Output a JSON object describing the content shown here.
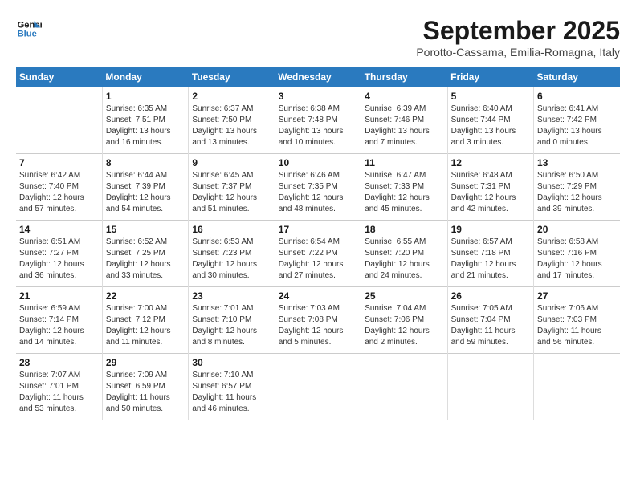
{
  "header": {
    "logo_line1": "General",
    "logo_line2": "Blue",
    "month": "September 2025",
    "location": "Porotto-Cassama, Emilia-Romagna, Italy"
  },
  "days_of_week": [
    "Sunday",
    "Monday",
    "Tuesday",
    "Wednesday",
    "Thursday",
    "Friday",
    "Saturday"
  ],
  "weeks": [
    [
      {
        "day": "",
        "info": ""
      },
      {
        "day": "1",
        "info": "Sunrise: 6:35 AM\nSunset: 7:51 PM\nDaylight: 13 hours\nand 16 minutes."
      },
      {
        "day": "2",
        "info": "Sunrise: 6:37 AM\nSunset: 7:50 PM\nDaylight: 13 hours\nand 13 minutes."
      },
      {
        "day": "3",
        "info": "Sunrise: 6:38 AM\nSunset: 7:48 PM\nDaylight: 13 hours\nand 10 minutes."
      },
      {
        "day": "4",
        "info": "Sunrise: 6:39 AM\nSunset: 7:46 PM\nDaylight: 13 hours\nand 7 minutes."
      },
      {
        "day": "5",
        "info": "Sunrise: 6:40 AM\nSunset: 7:44 PM\nDaylight: 13 hours\nand 3 minutes."
      },
      {
        "day": "6",
        "info": "Sunrise: 6:41 AM\nSunset: 7:42 PM\nDaylight: 13 hours\nand 0 minutes."
      }
    ],
    [
      {
        "day": "7",
        "info": "Sunrise: 6:42 AM\nSunset: 7:40 PM\nDaylight: 12 hours\nand 57 minutes."
      },
      {
        "day": "8",
        "info": "Sunrise: 6:44 AM\nSunset: 7:39 PM\nDaylight: 12 hours\nand 54 minutes."
      },
      {
        "day": "9",
        "info": "Sunrise: 6:45 AM\nSunset: 7:37 PM\nDaylight: 12 hours\nand 51 minutes."
      },
      {
        "day": "10",
        "info": "Sunrise: 6:46 AM\nSunset: 7:35 PM\nDaylight: 12 hours\nand 48 minutes."
      },
      {
        "day": "11",
        "info": "Sunrise: 6:47 AM\nSunset: 7:33 PM\nDaylight: 12 hours\nand 45 minutes."
      },
      {
        "day": "12",
        "info": "Sunrise: 6:48 AM\nSunset: 7:31 PM\nDaylight: 12 hours\nand 42 minutes."
      },
      {
        "day": "13",
        "info": "Sunrise: 6:50 AM\nSunset: 7:29 PM\nDaylight: 12 hours\nand 39 minutes."
      }
    ],
    [
      {
        "day": "14",
        "info": "Sunrise: 6:51 AM\nSunset: 7:27 PM\nDaylight: 12 hours\nand 36 minutes."
      },
      {
        "day": "15",
        "info": "Sunrise: 6:52 AM\nSunset: 7:25 PM\nDaylight: 12 hours\nand 33 minutes."
      },
      {
        "day": "16",
        "info": "Sunrise: 6:53 AM\nSunset: 7:23 PM\nDaylight: 12 hours\nand 30 minutes."
      },
      {
        "day": "17",
        "info": "Sunrise: 6:54 AM\nSunset: 7:22 PM\nDaylight: 12 hours\nand 27 minutes."
      },
      {
        "day": "18",
        "info": "Sunrise: 6:55 AM\nSunset: 7:20 PM\nDaylight: 12 hours\nand 24 minutes."
      },
      {
        "day": "19",
        "info": "Sunrise: 6:57 AM\nSunset: 7:18 PM\nDaylight: 12 hours\nand 21 minutes."
      },
      {
        "day": "20",
        "info": "Sunrise: 6:58 AM\nSunset: 7:16 PM\nDaylight: 12 hours\nand 17 minutes."
      }
    ],
    [
      {
        "day": "21",
        "info": "Sunrise: 6:59 AM\nSunset: 7:14 PM\nDaylight: 12 hours\nand 14 minutes."
      },
      {
        "day": "22",
        "info": "Sunrise: 7:00 AM\nSunset: 7:12 PM\nDaylight: 12 hours\nand 11 minutes."
      },
      {
        "day": "23",
        "info": "Sunrise: 7:01 AM\nSunset: 7:10 PM\nDaylight: 12 hours\nand 8 minutes."
      },
      {
        "day": "24",
        "info": "Sunrise: 7:03 AM\nSunset: 7:08 PM\nDaylight: 12 hours\nand 5 minutes."
      },
      {
        "day": "25",
        "info": "Sunrise: 7:04 AM\nSunset: 7:06 PM\nDaylight: 12 hours\nand 2 minutes."
      },
      {
        "day": "26",
        "info": "Sunrise: 7:05 AM\nSunset: 7:04 PM\nDaylight: 11 hours\nand 59 minutes."
      },
      {
        "day": "27",
        "info": "Sunrise: 7:06 AM\nSunset: 7:03 PM\nDaylight: 11 hours\nand 56 minutes."
      }
    ],
    [
      {
        "day": "28",
        "info": "Sunrise: 7:07 AM\nSunset: 7:01 PM\nDaylight: 11 hours\nand 53 minutes."
      },
      {
        "day": "29",
        "info": "Sunrise: 7:09 AM\nSunset: 6:59 PM\nDaylight: 11 hours\nand 50 minutes."
      },
      {
        "day": "30",
        "info": "Sunrise: 7:10 AM\nSunset: 6:57 PM\nDaylight: 11 hours\nand 46 minutes."
      },
      {
        "day": "",
        "info": ""
      },
      {
        "day": "",
        "info": ""
      },
      {
        "day": "",
        "info": ""
      },
      {
        "day": "",
        "info": ""
      }
    ]
  ]
}
